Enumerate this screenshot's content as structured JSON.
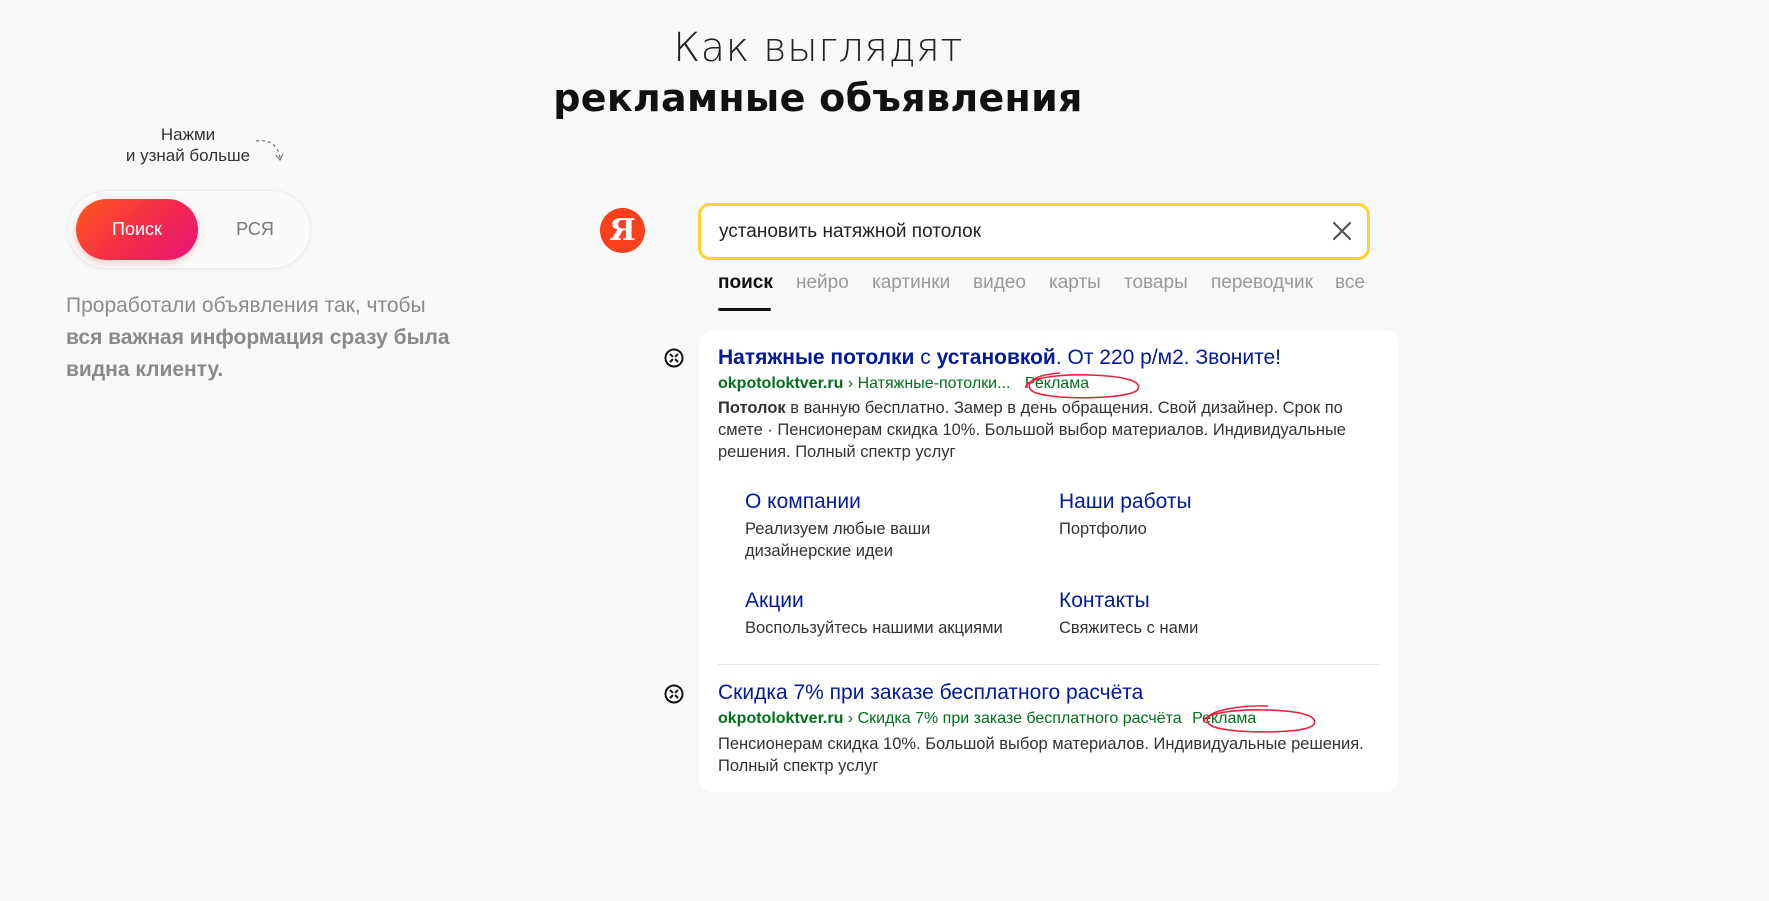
{
  "heading": {
    "line1": "Как выглядят",
    "line2": "рекламные объявления"
  },
  "hint": {
    "line1": "Нажми",
    "line2": "и узнай больше"
  },
  "switch": {
    "active": "Поиск",
    "inactive": "РСЯ"
  },
  "description": {
    "lead": "Проработали объявления так, чтобы",
    "bold": "вся важная информация сразу была видна клиенту."
  },
  "yandex": {
    "logo_letter": "Я",
    "search_value": "установить натяжной потолок",
    "tabs": [
      "поиск",
      "нейро",
      "картинки",
      "видео",
      "карты",
      "товары",
      "переводчик",
      "все"
    ],
    "active_tab": 0
  },
  "results": [
    {
      "title_parts": [
        "Натяжные потолки",
        " с ",
        "установкой",
        ". От 220 р/м2. Звоните!"
      ],
      "domain": "okpotoloktver.ru",
      "path": " › Натяжные-потолки...",
      "ad_label": "Реклама",
      "text_bold": "Потолок",
      "text": " в ванную бесплатно. Замер в день обращения. Свой дизайнер. Срок по смете · Пенсионерам скидка 10%. Большой выбор материалов. Индивидуальные решения. Полный спектр услуг",
      "sitelinks": [
        {
          "title": "О компании",
          "desc": "Реализуем любые ваши дизайнерские идеи"
        },
        {
          "title": "Наши работы",
          "desc": "Портфолио"
        },
        {
          "title": "Акции",
          "desc": "Воспользуйтесь нашими акциями"
        },
        {
          "title": "Контакты",
          "desc": "Свяжитесь с нами"
        }
      ]
    },
    {
      "title": "Скидка 7% при заказе бесплатного расчёта",
      "domain": "okpotoloktver.ru",
      "path": " › Скидка 7% при заказе бесплатного расчёта",
      "ad_label": "Реклама",
      "text": "Пенсионерам скидка 10%. Большой выбор материалов. Индивидуальные решения. Полный спектр услуг"
    }
  ],
  "colors": {
    "accent_gradient_start": "#ff5a1c",
    "accent_gradient_end": "#e9147a",
    "yandex_red": "#fc3f1d",
    "search_border": "#ffd22e",
    "link_blue": "#001a9a",
    "url_green": "#00701a",
    "annotation_red": "#e8213f"
  }
}
